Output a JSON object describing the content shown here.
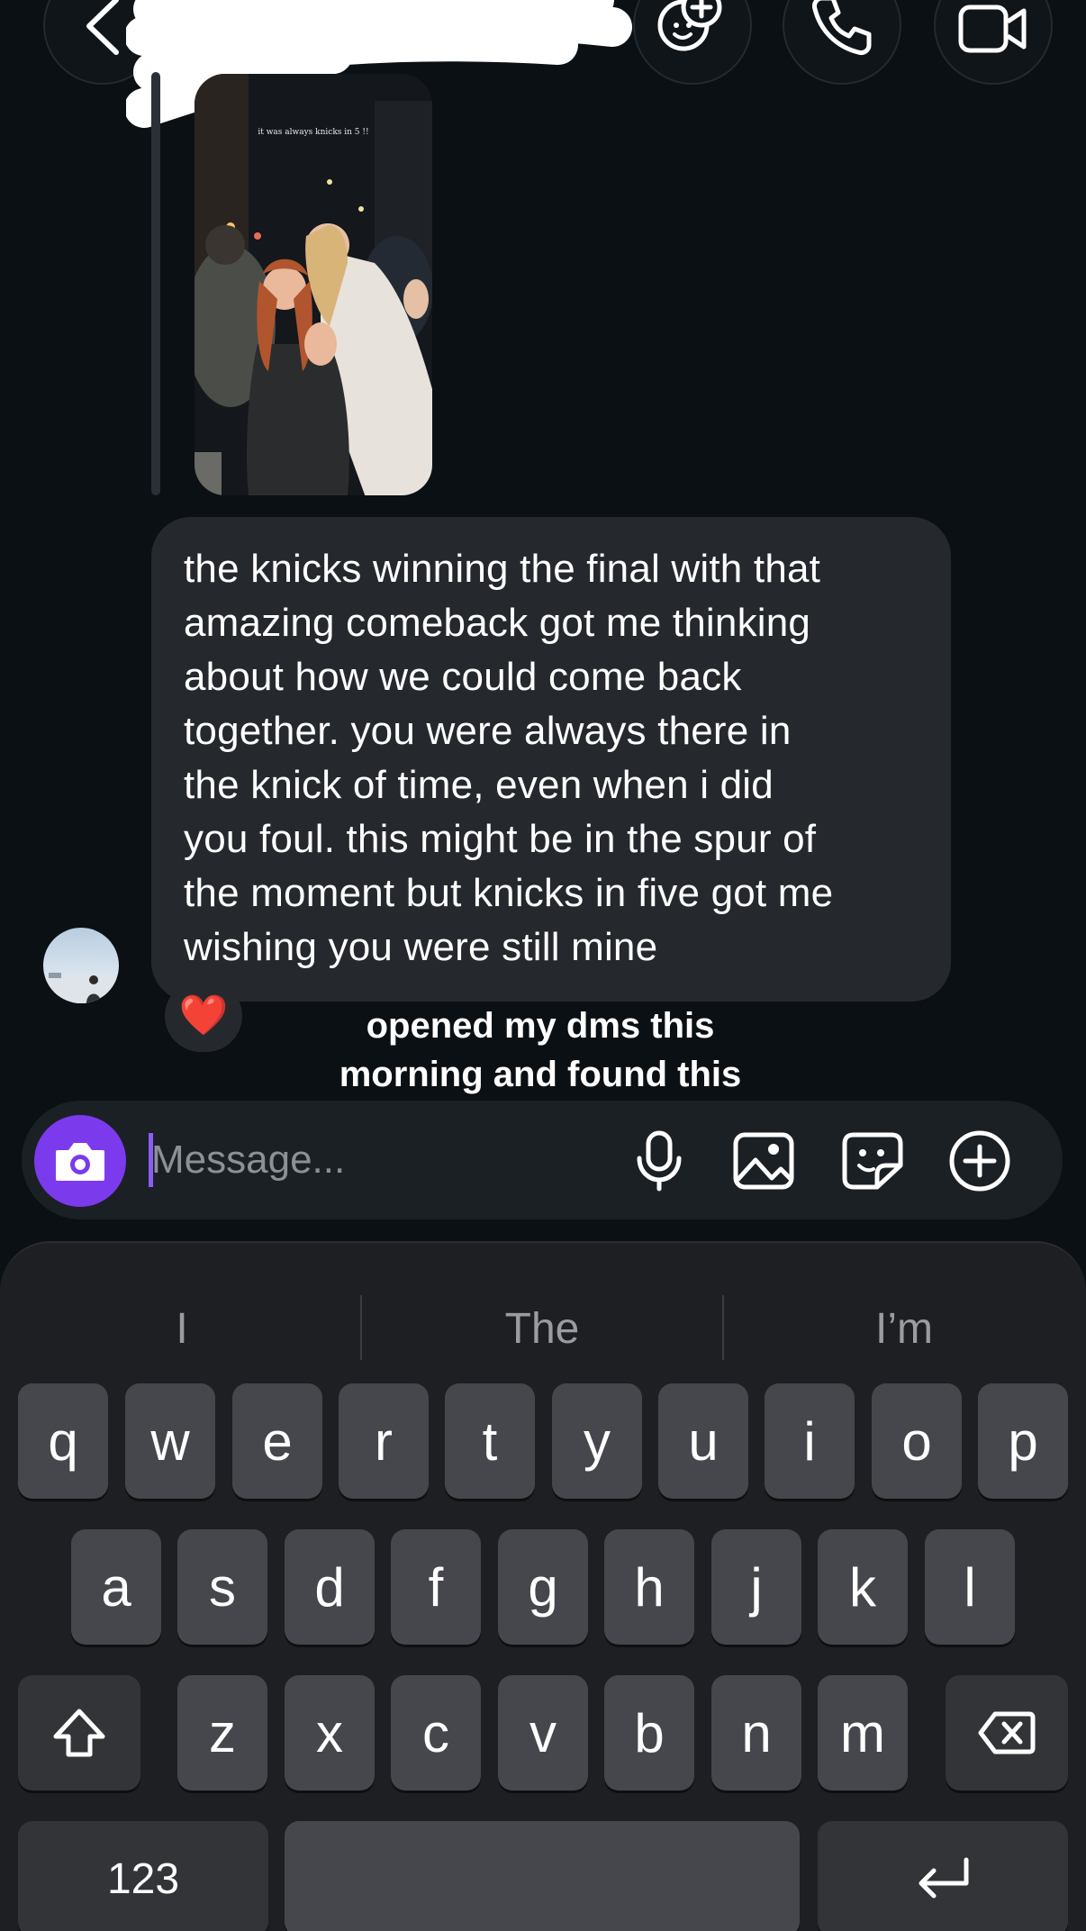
{
  "header": {
    "back_icon": "chevron-left-icon",
    "effects_icon": "effects-icon",
    "call_icon": "phone-icon",
    "video_icon": "video-camera-icon"
  },
  "story": {
    "caption": "it was always knicks in 5 !!"
  },
  "message": {
    "text": "the knicks winning the final with that\namazing comeback got me thinking\nabout how we could come back\ntogether. you were always there in\nthe knick of time, even when i did\nyou foul. this might be in the spur of\nthe moment but knicks in five got me\nwishing you were still mine",
    "reaction": "❤️"
  },
  "overlay": {
    "caption": "opened my dms this\nmorning and found this"
  },
  "composer": {
    "placeholder": "Message...",
    "value": "",
    "accent": "#7c3aed"
  },
  "keyboard": {
    "suggestions": [
      "I",
      "The",
      "I’m"
    ],
    "row1": [
      "q",
      "w",
      "e",
      "r",
      "t",
      "y",
      "u",
      "i",
      "o",
      "p"
    ],
    "row2": [
      "a",
      "s",
      "d",
      "f",
      "g",
      "h",
      "j",
      "k",
      "l"
    ],
    "row3": [
      "z",
      "x",
      "c",
      "v",
      "b",
      "n",
      "m"
    ],
    "numbers_label": "123"
  }
}
